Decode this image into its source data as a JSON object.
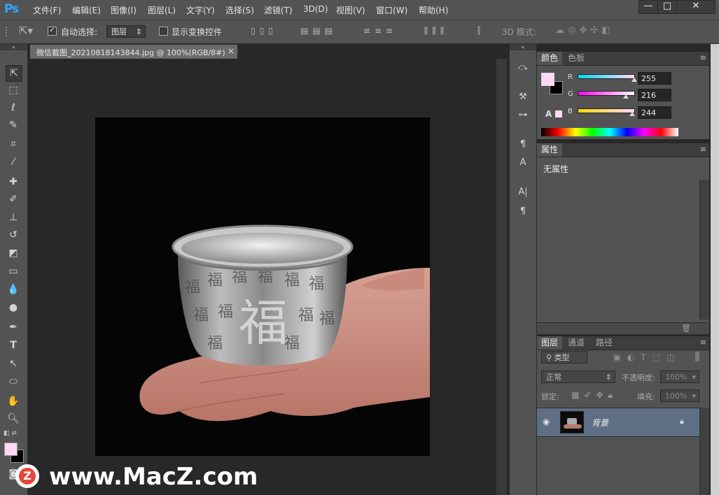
{
  "app": {
    "logo": "Ps"
  },
  "menu": [
    "文件(F)",
    "编辑(E)",
    "图像(I)",
    "图层(L)",
    "文字(Y)",
    "选择(S)",
    "滤镜(T)",
    "3D(D)",
    "视图(V)",
    "窗口(W)",
    "帮助(H)"
  ],
  "window_controls": {
    "minimize": "—",
    "maximize": "□",
    "close": "✕"
  },
  "options": {
    "auto_select_label": "自动选择:",
    "auto_select_value": "图层",
    "show_transform_label": "显示变换控件",
    "mode_3d_label": "3D 模式:"
  },
  "document": {
    "tab_title": "微信截图_20210818143844.jpg @ 100%(RGB/8#)",
    "close_glyph": "×"
  },
  "color_panel": {
    "tabs": [
      "颜色",
      "色板"
    ],
    "r_label": "R",
    "g_label": "G",
    "b_label": "B",
    "r": "255",
    "g": "216",
    "b": "244",
    "foreground": "#ffd8f4",
    "background": "#000000"
  },
  "properties_panel": {
    "tab": "属性",
    "empty_text": "无属性"
  },
  "layers_panel": {
    "tabs": [
      "图层",
      "通道",
      "路径"
    ],
    "filter_label": "类型",
    "blend_mode": "正常",
    "opacity_label": "不透明度:",
    "opacity_value": "100%",
    "lock_label": "锁定:",
    "fill_label": "填充:",
    "fill_value": "100%",
    "layers": [
      {
        "name": "背景",
        "visible": true,
        "locked": true
      }
    ]
  },
  "watermark": {
    "text": "www.MacZ.com",
    "logo_letter": "Z"
  },
  "colors": {
    "ui_gray": "#535353",
    "dark": "#282828",
    "accent": "#31a8ff",
    "selected_layer": "#5e6f85"
  }
}
